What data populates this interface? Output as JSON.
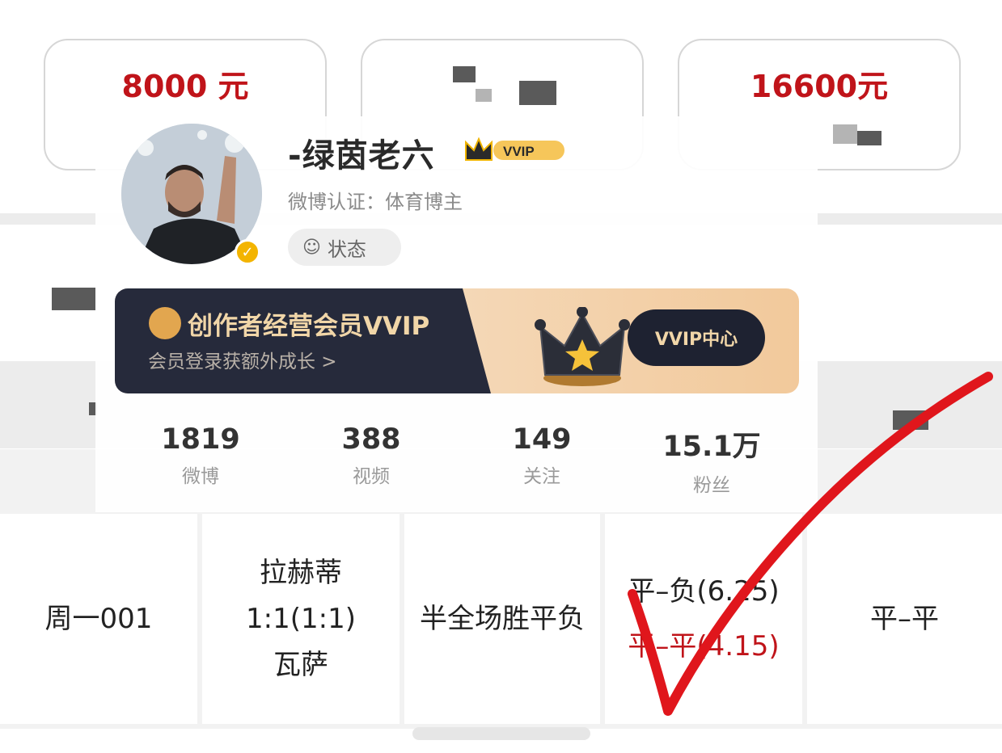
{
  "top_cards": [
    {
      "amount": "8000 元"
    },
    {
      "amount": ""
    },
    {
      "amount": "16600元"
    }
  ],
  "profile": {
    "name": "-绿茵老六",
    "vip_badge": "VVIP",
    "certification": "微博认证：体育博主",
    "status_button": "状态",
    "banner": {
      "title": "创作者经营会员VVIP",
      "subtitle": "会员登录获额外成长 >",
      "button": "VVIP中心"
    },
    "stats": [
      {
        "value": "1819",
        "label": "微博"
      },
      {
        "value": "388",
        "label": "视频"
      },
      {
        "value": "149",
        "label": "关注"
      },
      {
        "value": "15.1万",
        "label": "粉丝"
      }
    ]
  },
  "table_row": {
    "match_no": "周一001",
    "teams": [
      "拉赫蒂",
      "1:1(1:1)",
      "瓦萨"
    ],
    "play_type": "半全场胜平负",
    "pick_line1": "平–负(6.25)",
    "pick_line2": "平–平(4.15)",
    "result": "平–平"
  },
  "colors": {
    "accent_red": "#c0141a",
    "banner_dark": "#262a3b",
    "gold": "#f1d6a8"
  },
  "icons": [
    "crown-icon",
    "verified-badge-icon",
    "status-icon",
    "checkmark-annotation-icon"
  ]
}
